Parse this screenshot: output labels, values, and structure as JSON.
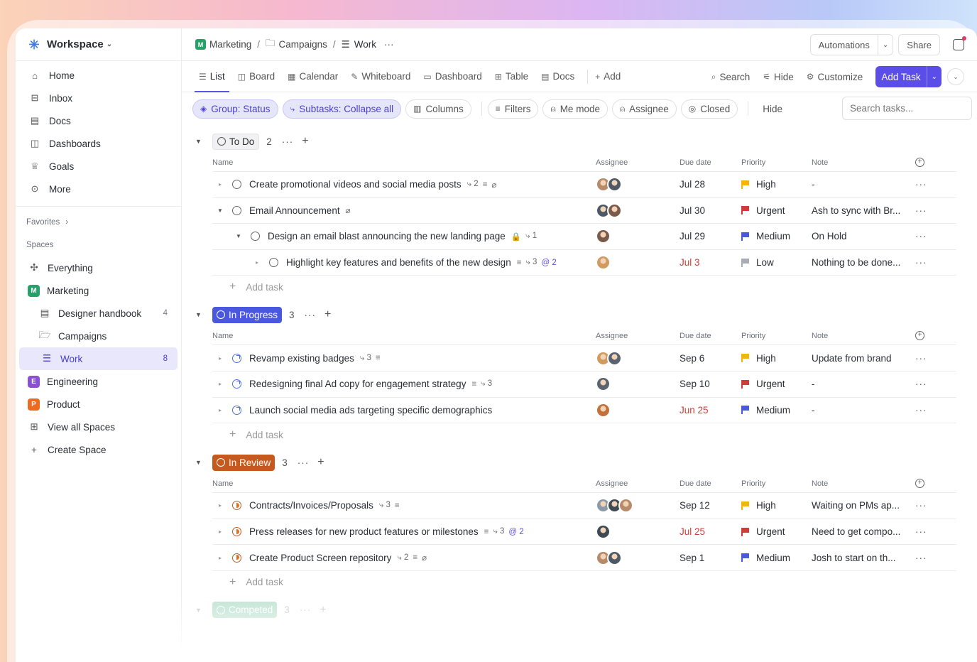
{
  "workspace": {
    "name": "Workspace"
  },
  "nav": [
    {
      "label": "Home",
      "icon": "home-icon"
    },
    {
      "label": "Inbox",
      "icon": "inbox-icon"
    },
    {
      "label": "Docs",
      "icon": "docs-icon"
    },
    {
      "label": "Dashboards",
      "icon": "dashboard-icon"
    },
    {
      "label": "Goals",
      "icon": "trophy-icon"
    },
    {
      "label": "More",
      "icon": "more-icon"
    }
  ],
  "sidebar": {
    "favorites": "Favorites",
    "spaces": "Spaces",
    "everything": "Everything",
    "marketing": {
      "badge": "M",
      "label": "Marketing",
      "color": "#26a269"
    },
    "designer_handbook": {
      "label": "Designer handbook",
      "count": "4"
    },
    "campaigns": {
      "label": "Campaigns"
    },
    "work": {
      "label": "Work",
      "count": "8"
    },
    "engineering": {
      "badge": "E",
      "label": "Engineering",
      "color": "#8a4fd6"
    },
    "product": {
      "badge": "P",
      "label": "Product",
      "color": "#ee6a1f"
    },
    "view_all": "View all Spaces",
    "create": "Create Space"
  },
  "breadcrumb": {
    "space": "Marketing",
    "folder": "Campaigns",
    "list": "Work",
    "more": "···"
  },
  "topbar": {
    "automations": "Automations",
    "share": "Share"
  },
  "views": {
    "tabs": [
      "List",
      "Board",
      "Calendar",
      "Whiteboard",
      "Dashboard",
      "Table",
      "Docs"
    ],
    "add": "Add",
    "search": "Search",
    "hide": "Hide",
    "customize": "Customize",
    "add_task": "Add Task"
  },
  "filters": {
    "group": "Group: Status",
    "subtasks": "Subtasks: Collapse all",
    "columns": "Columns",
    "filters": "Filters",
    "me_mode": "Me mode",
    "assignee": "Assignee",
    "closed": "Closed",
    "hide": "Hide",
    "search_placeholder": "Search tasks..."
  },
  "columns": {
    "name": "Name",
    "assignee": "Assignee",
    "due": "Due date",
    "priority": "Priority",
    "note": "Note"
  },
  "add_task_label": "Add task",
  "priority_colors": {
    "High": "#f2b705",
    "Urgent": "#d33b3b",
    "Medium": "#4a58e0",
    "Low": "#a8acb3"
  },
  "groups": [
    {
      "status": "To Do",
      "count": "2",
      "pill_bg": "#f1f1f3",
      "pill_fg": "#2a2e34",
      "tasks": [
        {
          "name": "Create promotional videos and social media posts",
          "meta": [
            "⤷ 2",
            "≡",
            "⌀"
          ],
          "due": "Jul 28",
          "overdue": false,
          "priority": "High",
          "note": "-",
          "avatars": 2,
          "level": 0
        },
        {
          "name": "Email Announcement",
          "meta": [
            "⌀"
          ],
          "due": "Jul 30",
          "overdue": false,
          "priority": "Urgent",
          "note": "Ash to sync with Br...",
          "avatars": 2,
          "level": 0,
          "expanded": true
        },
        {
          "name": "Design an email blast announcing the new landing page",
          "meta": [
            "🔒",
            "⤷ 1"
          ],
          "due": "Jul 29",
          "overdue": false,
          "priority": "Medium",
          "note": "On Hold",
          "avatars": 1,
          "level": 1,
          "expanded": true
        },
        {
          "name": "Highlight key features and benefits of the new design",
          "meta": [
            "≡",
            "⤷ 3",
            "@ 2"
          ],
          "due": "Jul 3",
          "overdue": true,
          "priority": "Low",
          "note": "Nothing to be done...",
          "avatars": 1,
          "level": 2
        }
      ]
    },
    {
      "status": "In Progress",
      "count": "3",
      "pill_bg": "#4a58e0",
      "pill_fg": "#ffffff",
      "tasks": [
        {
          "name": "Revamp existing badges",
          "meta": [
            "⤷ 3",
            "≡"
          ],
          "due": "Sep 6",
          "overdue": false,
          "priority": "High",
          "note": "Update from brand",
          "avatars": 2,
          "level": 0
        },
        {
          "name": "Redesigning final Ad copy for engagement strategy",
          "meta": [
            "≡",
            "⤷ 3"
          ],
          "due": "Sep 10",
          "overdue": false,
          "priority": "Urgent",
          "note": "-",
          "avatars": 1,
          "level": 0
        },
        {
          "name": "Launch social media ads targeting specific demographics",
          "meta": [],
          "due": "Jun 25",
          "overdue": true,
          "priority": "Medium",
          "note": "-",
          "avatars": 1,
          "level": 0
        }
      ]
    },
    {
      "status": "In Review",
      "count": "3",
      "pill_bg": "#c65a1e",
      "pill_fg": "#ffffff",
      "tasks": [
        {
          "name": "Contracts/Invoices/Proposals",
          "meta": [
            "⤷ 3",
            "≡"
          ],
          "due": "Sep 12",
          "overdue": false,
          "priority": "High",
          "note": "Waiting on PMs ap...",
          "avatars": 3,
          "level": 0
        },
        {
          "name": "Press releases for new product features or milestones",
          "meta": [
            "≡",
            "⤷ 3",
            "@ 2"
          ],
          "due": "Jul 25",
          "overdue": true,
          "priority": "Urgent",
          "note": "Need to get compo...",
          "avatars": 1,
          "level": 0
        },
        {
          "name": "Create Product Screen repository",
          "meta": [
            "⤷ 2",
            "≡",
            "⌀"
          ],
          "due": "Sep 1",
          "overdue": false,
          "priority": "Medium",
          "note": "Josh to start on th...",
          "avatars": 2,
          "level": 0
        }
      ]
    }
  ],
  "completed_group": {
    "status": "Competed",
    "count": "3"
  }
}
